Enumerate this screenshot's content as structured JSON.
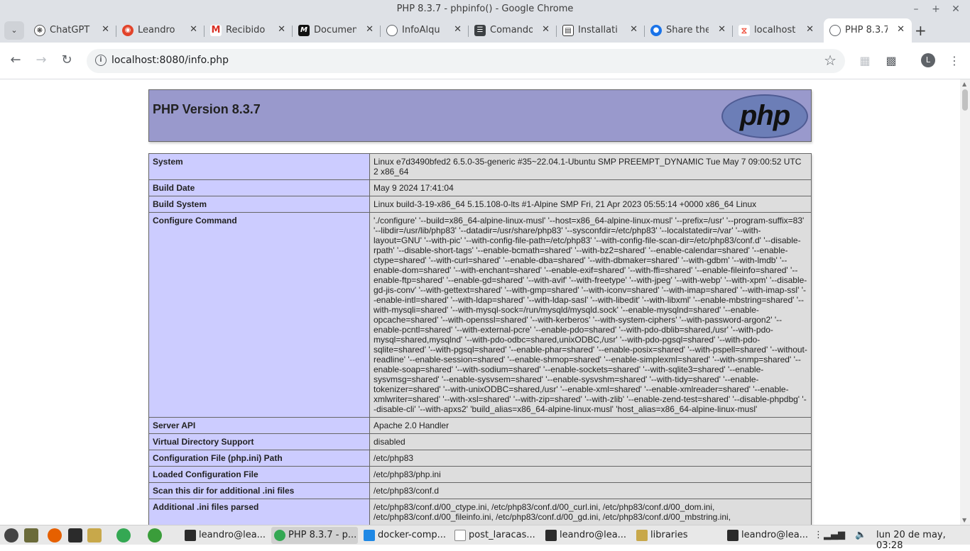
{
  "window": {
    "title": "PHP 8.3.7 - phpinfo() - Google Chrome"
  },
  "tabs": [
    {
      "label": "ChatGPT",
      "icon": "chatgpt-icon"
    },
    {
      "label": "Leandro",
      "icon": "gitlab-icon"
    },
    {
      "label": "Recibido",
      "icon": "gmail-icon"
    },
    {
      "label": "Documen",
      "icon": "m-docs-icon"
    },
    {
      "label": "InfoAlqu",
      "icon": "globe-icon"
    },
    {
      "label": "Comando",
      "icon": "terminal-doc-icon"
    },
    {
      "label": "Installati",
      "icon": "book-icon"
    },
    {
      "label": "Share the",
      "icon": "edge-share-icon"
    },
    {
      "label": "localhost",
      "icon": "laravel-icon"
    },
    {
      "label": "PHP 8.3.7",
      "icon": "globe-icon"
    }
  ],
  "toolbar": {
    "url": "localhost:8080/info.php",
    "profile_initial": "L"
  },
  "php": {
    "version_title": "PHP Version 8.3.7",
    "logo_text": "php",
    "rows": [
      {
        "key": "System",
        "value": "Linux e7d3490bfed2 6.5.0-35-generic #35~22.04.1-Ubuntu SMP PREEMPT_DYNAMIC Tue May 7 09:00:52 UTC 2 x86_64"
      },
      {
        "key": "Build Date",
        "value": "May 9 2024 17:41:04"
      },
      {
        "key": "Build System",
        "value": "Linux build-3-19-x86_64 5.15.108-0-lts #1-Alpine SMP Fri, 21 Apr 2023 05:55:14 +0000 x86_64 Linux"
      },
      {
        "key": "Configure Command",
        "value": "'./configure' '--build=x86_64-alpine-linux-musl' '--host=x86_64-alpine-linux-musl' '--prefix=/usr' '--program-suffix=83' '--libdir=/usr/lib/php83' '--datadir=/usr/share/php83' '--sysconfdir=/etc/php83' '--localstatedir=/var' '--with-layout=GNU' '--with-pic' '--with-config-file-path=/etc/php83' '--with-config-file-scan-dir=/etc/php83/conf.d' '--disable-rpath' '--disable-short-tags' '--enable-bcmath=shared' '--with-bz2=shared' '--enable-calendar=shared' '--enable-ctype=shared' '--with-curl=shared' '--enable-dba=shared' '--with-dbmaker=shared' '--with-gdbm' '--with-lmdb' '--enable-dom=shared' '--with-enchant=shared' '--enable-exif=shared' '--with-ffi=shared' '--enable-fileinfo=shared' '--enable-ftp=shared' '--enable-gd=shared' '--with-avif' '--with-freetype' '--with-jpeg' '--with-webp' '--with-xpm' '--disable-gd-jis-conv' '--with-gettext=shared' '--with-gmp=shared' '--with-iconv=shared' '--with-imap=shared' '--with-imap-ssl' '--enable-intl=shared' '--with-ldap=shared' '--with-ldap-sasl' '--with-libedit' '--with-libxml' '--enable-mbstring=shared' '--with-mysqli=shared' '--with-mysql-sock=/run/mysqld/mysqld.sock' '--enable-mysqlnd=shared' '--enable-opcache=shared' '--with-openssl=shared' '--with-kerberos' '--with-system-ciphers' '--with-password-argon2' '--enable-pcntl=shared' '--with-external-pcre' '--enable-pdo=shared' '--with-pdo-dblib=shared,/usr' '--with-pdo-mysql=shared,mysqlnd' '--with-pdo-odbc=shared,unixODBC,/usr' '--with-pdo-pgsql=shared' '--with-pdo-sqlite=shared' '--with-pgsql=shared' '--enable-phar=shared' '--enable-posix=shared' '--with-pspell=shared' '--without-readline' '--enable-session=shared' '--enable-shmop=shared' '--enable-simplexml=shared' '--with-snmp=shared' '--enable-soap=shared' '--with-sodium=shared' '--enable-sockets=shared' '--with-sqlite3=shared' '--enable-sysvmsg=shared' '--enable-sysvsem=shared' '--enable-sysvshm=shared' '--with-tidy=shared' '--enable-tokenizer=shared' '--with-unixODBC=shared,/usr' '--enable-xml=shared' '--enable-xmlreader=shared' '--enable-xmlwriter=shared' '--with-xsl=shared' '--with-zip=shared' '--with-zlib' '--enable-zend-test=shared' '--disable-phpdbg' '--disable-cli' '--with-apxs2' 'build_alias=x86_64-alpine-linux-musl' 'host_alias=x86_64-alpine-linux-musl'"
      },
      {
        "key": "Server API",
        "value": "Apache 2.0 Handler"
      },
      {
        "key": "Virtual Directory Support",
        "value": "disabled"
      },
      {
        "key": "Configuration File (php.ini) Path",
        "value": "/etc/php83"
      },
      {
        "key": "Loaded Configuration File",
        "value": "/etc/php83/php.ini"
      },
      {
        "key": "Scan this dir for additional .ini files",
        "value": "/etc/php83/conf.d"
      },
      {
        "key": "Additional .ini files parsed",
        "value": "/etc/php83/conf.d/00_ctype.ini, /etc/php83/conf.d/00_curl.ini, /etc/php83/conf.d/00_dom.ini, /etc/php83/conf.d/00_fileinfo.ini, /etc/php83/conf.d/00_gd.ini, /etc/php83/conf.d/00_mbstring.ini,"
      }
    ]
  },
  "taskbar": {
    "tasks": [
      {
        "label": "leandro@lea..."
      },
      {
        "label": "PHP 8.3.7 - p..."
      },
      {
        "label": "docker-comp..."
      },
      {
        "label": "post_laracas..."
      },
      {
        "label": "leandro@lea..."
      },
      {
        "label": "libraries"
      },
      {
        "label": "leandro@lea..."
      }
    ],
    "clock": "lun 20 de may, 03:28"
  },
  "colors": {
    "php_header": "#9999cc",
    "php_key_bg": "#ccccff",
    "php_value_bg": "#dddddd",
    "chrome_frame": "#dee1e6"
  }
}
